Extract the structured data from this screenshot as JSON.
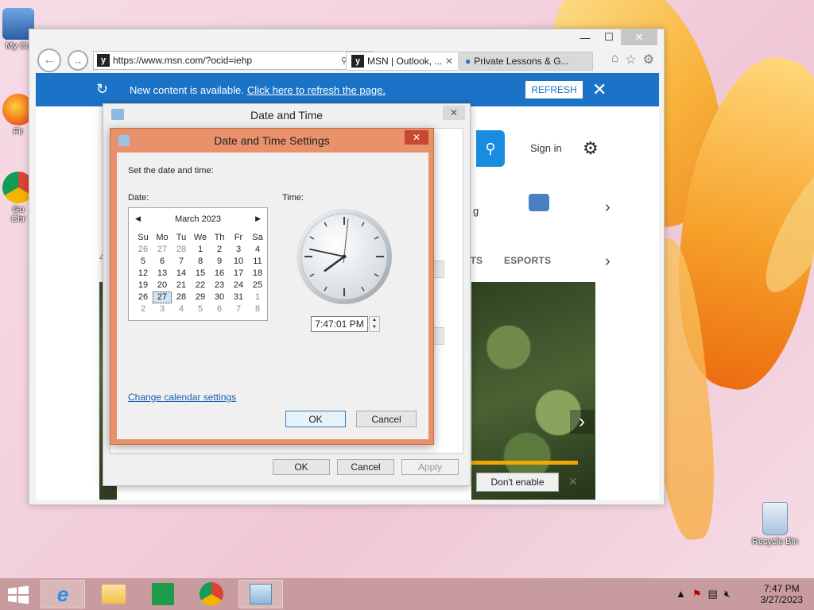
{
  "desktop": {
    "icons": {
      "my_computer": "My Co",
      "firefox": "Fir",
      "chrome_line1": "Go",
      "chrome_line2": "Chr",
      "recycle_bin": "Recycle Bin"
    }
  },
  "browser": {
    "address": "https://www.msn.com/?ocid=iehp",
    "tabs": [
      {
        "label": "MSN | Outlook, ...",
        "active": true
      },
      {
        "label": "Private Lessons & G...",
        "active": false
      }
    ],
    "notification": {
      "text": "New content is available.",
      "link": "Click here to refresh the page.",
      "button": "REFRESH"
    },
    "page": {
      "sign_in": "Sign in",
      "weather_text": "g",
      "nav_sports": "RTS",
      "nav_esports": "ESPORTS",
      "side_char_e": "e",
      "side_char_4": "4",
      "dont_enable": "Don't enable"
    }
  },
  "dialog_outer": {
    "title": "Date and Time",
    "buttons": {
      "ok": "OK",
      "cancel": "Cancel",
      "apply": "Apply"
    }
  },
  "dialog_inner": {
    "title": "Date and Time Settings",
    "instruction": "Set the date and time:",
    "date_label": "Date:",
    "time_label": "Time:",
    "calendar": {
      "month": "March 2023",
      "weekdays": [
        "Su",
        "Mo",
        "Tu",
        "We",
        "Th",
        "Fr",
        "Sa"
      ],
      "weeks": [
        [
          "26",
          "27",
          "28",
          "1",
          "2",
          "3",
          "4"
        ],
        [
          "5",
          "6",
          "7",
          "8",
          "9",
          "10",
          "11"
        ],
        [
          "12",
          "13",
          "14",
          "15",
          "16",
          "17",
          "18"
        ],
        [
          "19",
          "20",
          "21",
          "22",
          "23",
          "24",
          "25"
        ],
        [
          "26",
          "27",
          "28",
          "29",
          "30",
          "31",
          "1"
        ],
        [
          "2",
          "3",
          "4",
          "5",
          "6",
          "7",
          "8"
        ]
      ],
      "selected": "27"
    },
    "time_value": "7:47:01 PM",
    "change_calendar_link": "Change calendar settings",
    "buttons": {
      "ok": "OK",
      "cancel": "Cancel"
    }
  },
  "taskbar": {
    "clock_time": "7:47 PM",
    "clock_date": "3/27/2023"
  },
  "colors": {
    "accent": "#1a73c6",
    "dialog_frame": "#e8916b",
    "close_red": "#c7482e",
    "taskbar": "#c89b9e"
  }
}
